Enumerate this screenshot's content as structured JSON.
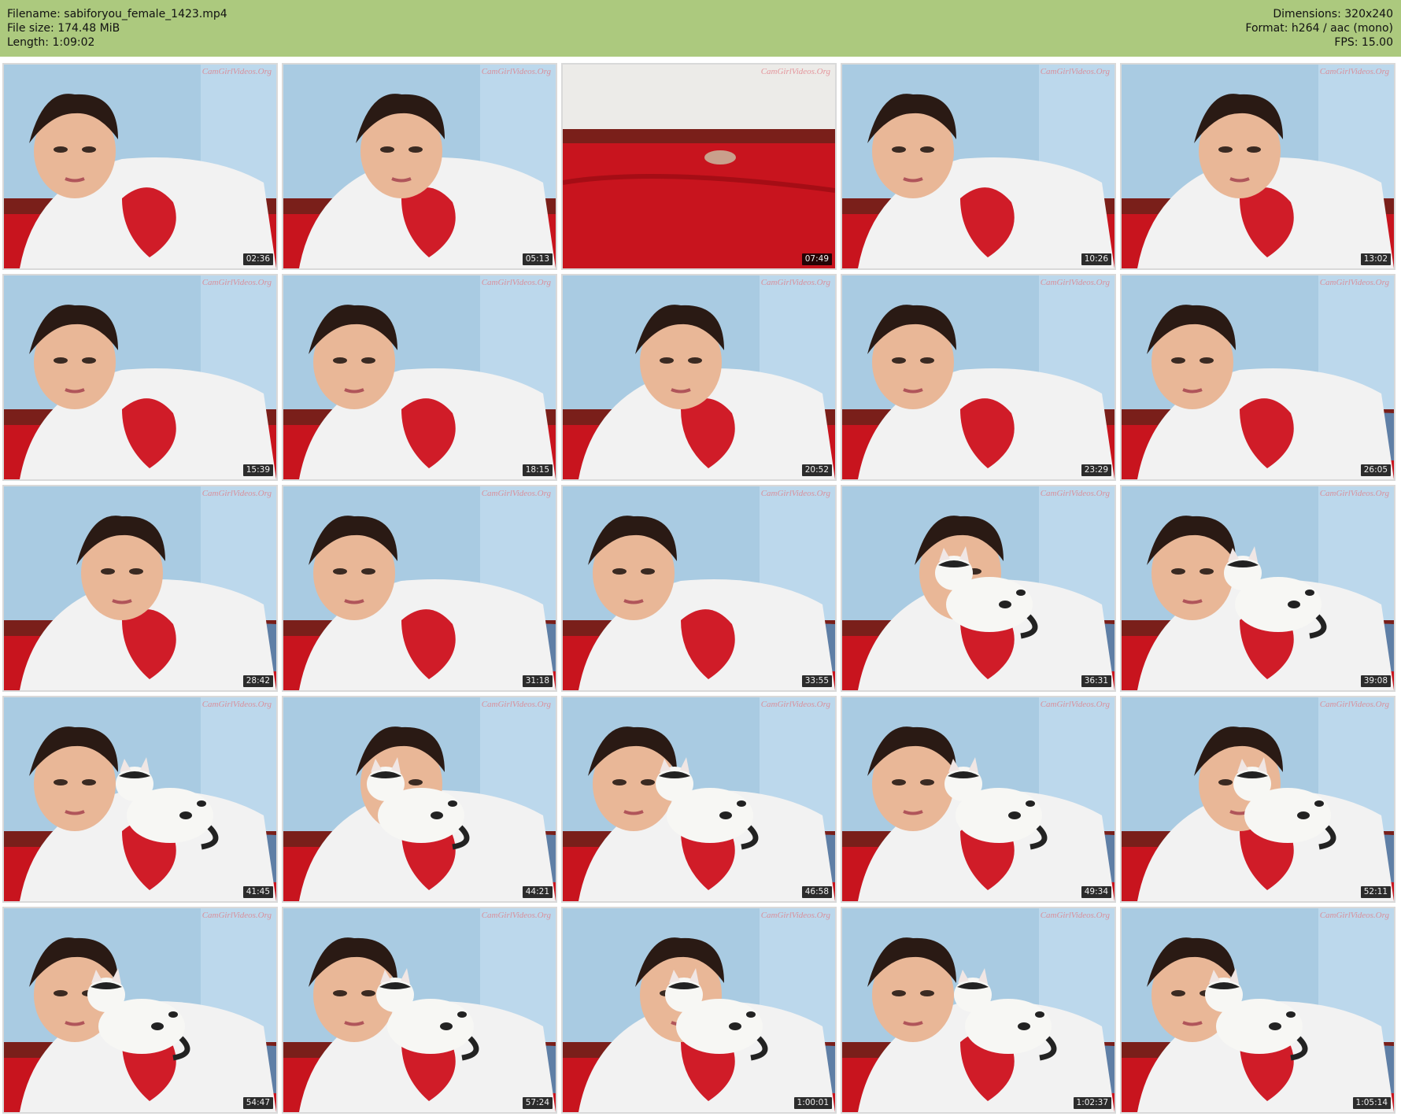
{
  "header": {
    "filename_line": "Filename: sabiforyou_female_1423.mp4",
    "filesize_line": "File size: 174.48 MiB",
    "length_line": "Length: 1:09:02",
    "dimensions_line": "Dimensions: 320x240",
    "format_line": "Format: h264 / aac (mono)",
    "fps_line": "FPS: 15.00"
  },
  "watermark": "CamGirlVideos.Org",
  "colors": {
    "header_bg": "#acc97e",
    "wall": "#a9cbe2",
    "bed": "#c8141e",
    "shirt": "#f2f2f2",
    "skin": "#e9b797",
    "hair": "#2a1a14"
  },
  "thumbnails": [
    {
      "time": "02:36",
      "scene": "girl"
    },
    {
      "time": "05:13",
      "scene": "girl"
    },
    {
      "time": "07:49",
      "scene": "empty"
    },
    {
      "time": "10:26",
      "scene": "girl"
    },
    {
      "time": "13:02",
      "scene": "girl"
    },
    {
      "time": "15:39",
      "scene": "girl"
    },
    {
      "time": "18:15",
      "scene": "girl"
    },
    {
      "time": "20:52",
      "scene": "girl"
    },
    {
      "time": "23:29",
      "scene": "girl"
    },
    {
      "time": "26:05",
      "scene": "girl"
    },
    {
      "time": "28:42",
      "scene": "girl"
    },
    {
      "time": "31:18",
      "scene": "girl"
    },
    {
      "time": "33:55",
      "scene": "girl"
    },
    {
      "time": "36:31",
      "scene": "cat"
    },
    {
      "time": "39:08",
      "scene": "cat"
    },
    {
      "time": "41:45",
      "scene": "cat"
    },
    {
      "time": "44:21",
      "scene": "cat"
    },
    {
      "time": "46:58",
      "scene": "cat"
    },
    {
      "time": "49:34",
      "scene": "cat"
    },
    {
      "time": "52:11",
      "scene": "cat"
    },
    {
      "time": "54:47",
      "scene": "cat"
    },
    {
      "time": "57:24",
      "scene": "cat"
    },
    {
      "time": "1:00:01",
      "scene": "cat"
    },
    {
      "time": "1:02:37",
      "scene": "cat"
    },
    {
      "time": "1:05:14",
      "scene": "cat"
    }
  ]
}
